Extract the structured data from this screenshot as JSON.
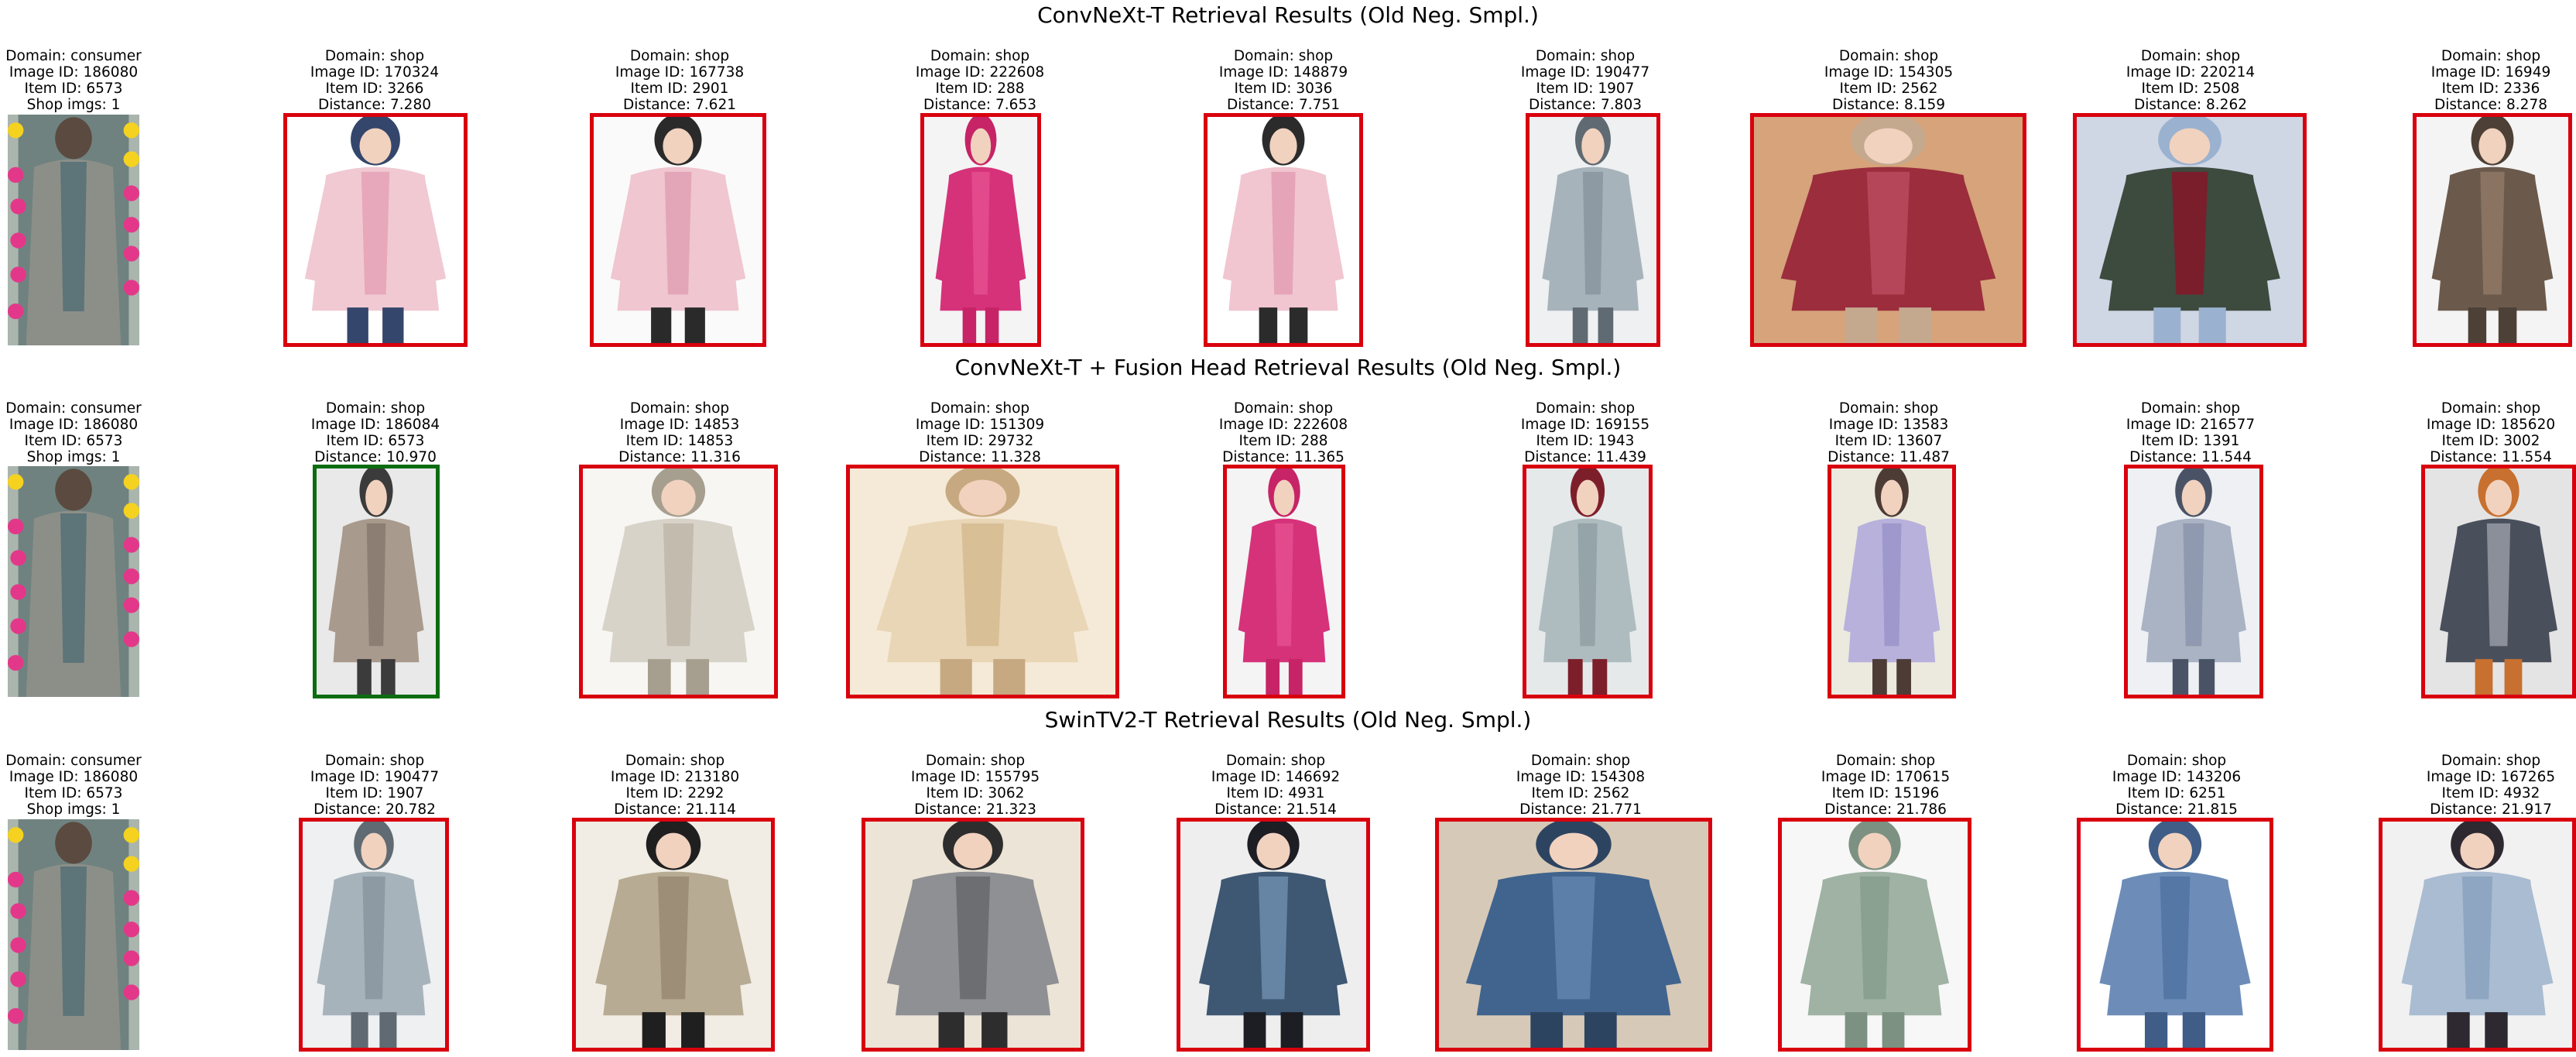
{
  "colors": {
    "wrong": "#d9000e",
    "correct": "#0b6d10"
  },
  "rows": [
    {
      "title": "ConvNeXt-T Retrieval Results (Old Neg. Smpl.)",
      "query": {
        "domain": "Domain: consumer",
        "image_id": "Image ID: 186080",
        "item_id": "Item ID: 6573",
        "shop_imgs": "Shop imgs: 1"
      },
      "results": [
        {
          "domain": "Domain: shop",
          "image_id": "Image ID: 170324",
          "item_id": "Item ID: 3266",
          "distance": "Distance: 7.280",
          "match": false,
          "palette": [
            "#f1c9d3",
            "#e7a8bb",
            "#ffffff",
            "#34466b"
          ]
        },
        {
          "domain": "Domain: shop",
          "image_id": "Image ID: 167738",
          "item_id": "Item ID: 2901",
          "distance": "Distance: 7.621",
          "match": false,
          "palette": [
            "#f0c6d0",
            "#e3a6b9",
            "#fafafa",
            "#2a2a2a"
          ]
        },
        {
          "domain": "Domain: shop",
          "image_id": "Image ID: 222608",
          "item_id": "Item ID: 288",
          "distance": "Distance: 7.653",
          "match": false,
          "palette": [
            "#d6327a",
            "#e24a8c",
            "#f4f4f4",
            "#c62466"
          ]
        },
        {
          "domain": "Domain: shop",
          "image_id": "Image ID: 148879",
          "item_id": "Item ID: 3036",
          "distance": "Distance: 7.751",
          "match": false,
          "palette": [
            "#f1c6d0",
            "#e5a4b8",
            "#ffffff",
            "#2b2b2b"
          ]
        },
        {
          "domain": "Domain: shop",
          "image_id": "Image ID: 190477",
          "item_id": "Item ID: 1907",
          "distance": "Distance: 7.803",
          "match": false,
          "palette": [
            "#a7b3bb",
            "#8d9aa4",
            "#eef0f1",
            "#5f6a72"
          ]
        },
        {
          "domain": "Domain: shop",
          "image_id": "Image ID: 154305",
          "item_id": "Item ID: 2562",
          "distance": "Distance: 8.159",
          "match": false,
          "palette": [
            "#9b2d3d",
            "#b5465a",
            "#d6a37a",
            "#c4a98f"
          ]
        },
        {
          "domain": "Domain: shop",
          "image_id": "Image ID: 220214",
          "item_id": "Item ID: 2508",
          "distance": "Distance: 8.262",
          "match": false,
          "palette": [
            "#3d4a3e",
            "#7a1e2c",
            "#cfd6e4",
            "#9ab2cf"
          ]
        },
        {
          "domain": "Domain: shop",
          "image_id": "Image ID: 16949",
          "item_id": "Item ID: 2336",
          "distance": "Distance: 8.278",
          "match": false,
          "palette": [
            "#6b5a4c",
            "#8a7361",
            "#f4f4f4",
            "#4d4036"
          ]
        }
      ]
    },
    {
      "title": "ConvNeXt-T + Fusion Head Retrieval Results (Old Neg. Smpl.)",
      "query": {
        "domain": "Domain: consumer",
        "image_id": "Image ID: 186080",
        "item_id": "Item ID: 6573",
        "shop_imgs": "Shop imgs: 1"
      },
      "results": [
        {
          "domain": "Domain: shop",
          "image_id": "Image ID: 186084",
          "item_id": "Item ID: 6573",
          "distance": "Distance: 10.970",
          "match": true,
          "palette": [
            "#a99a8e",
            "#8d7e73",
            "#e9e9e9",
            "#3b3b3b"
          ]
        },
        {
          "domain": "Domain: shop",
          "image_id": "Image ID: 14853",
          "item_id": "Item ID: 14853",
          "distance": "Distance: 11.316",
          "match": false,
          "palette": [
            "#d8d3c9",
            "#c3bcae",
            "#f7f6f3",
            "#a69e8f"
          ]
        },
        {
          "domain": "Domain: shop",
          "image_id": "Image ID: 151309",
          "item_id": "Item ID: 29732",
          "distance": "Distance: 11.328",
          "match": false,
          "palette": [
            "#e9d6b6",
            "#d9bf96",
            "#f5ead7",
            "#c7a981"
          ]
        },
        {
          "domain": "Domain: shop",
          "image_id": "Image ID: 222608",
          "item_id": "Item ID: 288",
          "distance": "Distance: 11.365",
          "match": false,
          "palette": [
            "#d6327a",
            "#e24a8c",
            "#f4f4f4",
            "#c62466"
          ]
        },
        {
          "domain": "Domain: shop",
          "image_id": "Image ID: 169155",
          "item_id": "Item ID: 1943",
          "distance": "Distance: 11.439",
          "match": false,
          "palette": [
            "#aebcbf",
            "#94a4a8",
            "#e5e9ea",
            "#7d1f2a"
          ]
        },
        {
          "domain": "Domain: shop",
          "image_id": "Image ID: 13583",
          "item_id": "Item ID: 13607",
          "distance": "Distance: 11.487",
          "match": false,
          "palette": [
            "#b7b1dc",
            "#9f98cc",
            "#ece9df",
            "#4d3b35"
          ]
        },
        {
          "domain": "Domain: shop",
          "image_id": "Image ID: 216577",
          "item_id": "Item ID: 1391",
          "distance": "Distance: 11.544",
          "match": false,
          "palette": [
            "#a9b3c3",
            "#8f9ab0",
            "#eef0f4",
            "#4a5366"
          ]
        },
        {
          "domain": "Domain: shop",
          "image_id": "Image ID: 185620",
          "item_id": "Item ID: 3002",
          "distance": "Distance: 11.554",
          "match": false,
          "palette": [
            "#4a4f5c",
            "#8a8f99",
            "#e4e4e4",
            "#c7702f"
          ]
        }
      ]
    },
    {
      "title": "SwinTV2-T Retrieval Results (Old Neg. Smpl.)",
      "query": {
        "domain": "Domain: consumer",
        "image_id": "Image ID: 186080",
        "item_id": "Item ID: 6573",
        "shop_imgs": "Shop imgs: 1"
      },
      "results": [
        {
          "domain": "Domain: shop",
          "image_id": "Image ID: 190477",
          "item_id": "Item ID: 1907",
          "distance": "Distance: 20.782",
          "match": false,
          "palette": [
            "#a7b3bb",
            "#8d9aa4",
            "#eef0f1",
            "#5f6a72"
          ]
        },
        {
          "domain": "Domain: shop",
          "image_id": "Image ID: 213180",
          "item_id": "Item ID: 2292",
          "distance": "Distance: 21.114",
          "match": false,
          "palette": [
            "#b8ab94",
            "#9c8e77",
            "#f1ede4",
            "#1f1f1f"
          ]
        },
        {
          "domain": "Domain: shop",
          "image_id": "Image ID: 155795",
          "item_id": "Item ID: 3062",
          "distance": "Distance: 21.323",
          "match": false,
          "palette": [
            "#8f9093",
            "#6d6e71",
            "#ece4d6",
            "#2d2d2d"
          ]
        },
        {
          "domain": "Domain: shop",
          "image_id": "Image ID: 146692",
          "item_id": "Item ID: 4931",
          "distance": "Distance: 21.514",
          "match": false,
          "palette": [
            "#3e5772",
            "#6684a3",
            "#eeeeee",
            "#1d1d24"
          ]
        },
        {
          "domain": "Domain: shop",
          "image_id": "Image ID: 154308",
          "item_id": "Item ID: 2562",
          "distance": "Distance: 21.771",
          "match": false,
          "palette": [
            "#40648d",
            "#5b7fa8",
            "#d7c9b7",
            "#2d4460"
          ]
        },
        {
          "domain": "Domain: shop",
          "image_id": "Image ID: 170615",
          "item_id": "Item ID: 15196",
          "distance": "Distance: 21.786",
          "match": false,
          "palette": [
            "#9fb2a4",
            "#8aa090",
            "#f7f7f7",
            "#7c9181"
          ]
        },
        {
          "domain": "Domain: shop",
          "image_id": "Image ID: 143206",
          "item_id": "Item ID: 6251",
          "distance": "Distance: 21.815",
          "match": false,
          "palette": [
            "#6d8db8",
            "#5577a6",
            "#ffffff",
            "#3f5d86"
          ]
        },
        {
          "domain": "Domain: shop",
          "image_id": "Image ID: 167265",
          "item_id": "Item ID: 4932",
          "distance": "Distance: 21.917",
          "match": false,
          "palette": [
            "#a9bcd1",
            "#8ea6c1",
            "#f1f1f1",
            "#2e2830"
          ]
        }
      ]
    }
  ]
}
